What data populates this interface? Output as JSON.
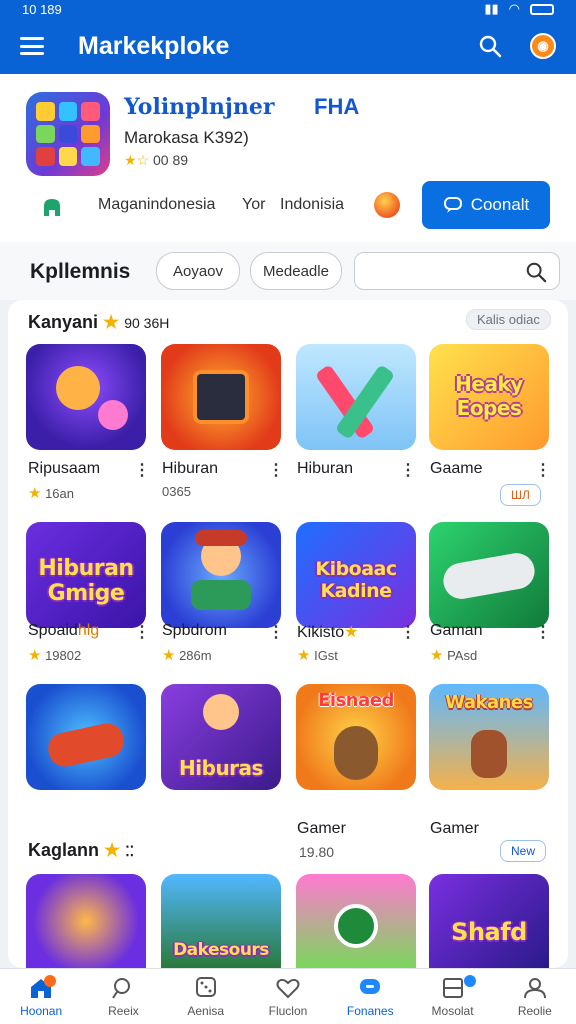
{
  "status": {
    "time": "10 189"
  },
  "app": {
    "title": "Markekploke"
  },
  "colors": {
    "primary": "#0a63d4",
    "accent": "#f2b300"
  },
  "featured": {
    "name": "Yolinplnjner",
    "tag": "FHA",
    "developer": "Marokasa K392)",
    "rating": "00 89",
    "labels": [
      "Maganindonesia",
      "Yor",
      "Indonisia"
    ],
    "install_label": "Coonalt"
  },
  "filters": {
    "heading": "Kpllemnis",
    "chips": [
      "Aoyaov",
      "Medeadle"
    ],
    "search_placeholder": ""
  },
  "section1": {
    "title": "Kanyani",
    "rating": "90 36H",
    "see_all": "Kalis odiac"
  },
  "row1": [
    {
      "name": "Ripusaam",
      "meta": "16an",
      "star": true
    },
    {
      "name": "Hiburan",
      "meta": "0365",
      "star": false
    },
    {
      "name": "Hiburan",
      "meta": "",
      "star": false
    },
    {
      "name": "Gaame",
      "meta": "",
      "star": false,
      "pill": "ШЛ"
    }
  ],
  "row2": [
    {
      "name": "Spoaid",
      "name_suffix": "hlg",
      "meta": "19802",
      "star": true,
      "art_label": "Hiburan Gmige"
    },
    {
      "name": "Spbdrom",
      "meta": "286m",
      "star": true
    },
    {
      "name": "Kikisto",
      "meta": "IGst",
      "star": true,
      "art_label": "Kiboaac Kadine"
    },
    {
      "name": "Gaman",
      "meta": "PAsd",
      "star": true
    }
  ],
  "row3": [
    {
      "name": "",
      "meta": ""
    },
    {
      "name": "",
      "meta": "",
      "art_label": "Hiburas"
    },
    {
      "name": "Gamer",
      "meta": "19.80",
      "art_label": "Eisnaed"
    },
    {
      "name": "Gamer",
      "meta": "",
      "art_label": "Wakanes",
      "pill": "New"
    }
  ],
  "section2": {
    "title": "Kaglann"
  },
  "row4": [
    {
      "art_label": ""
    },
    {
      "art_label": "Dakesours"
    },
    {
      "art_label": ""
    },
    {
      "art_label": "Shafd"
    }
  ],
  "nav": [
    "Hoonan",
    "Reeix",
    "Aenisa",
    "Fluclon",
    "Fonanes",
    "Mosolat",
    "Reolie"
  ]
}
